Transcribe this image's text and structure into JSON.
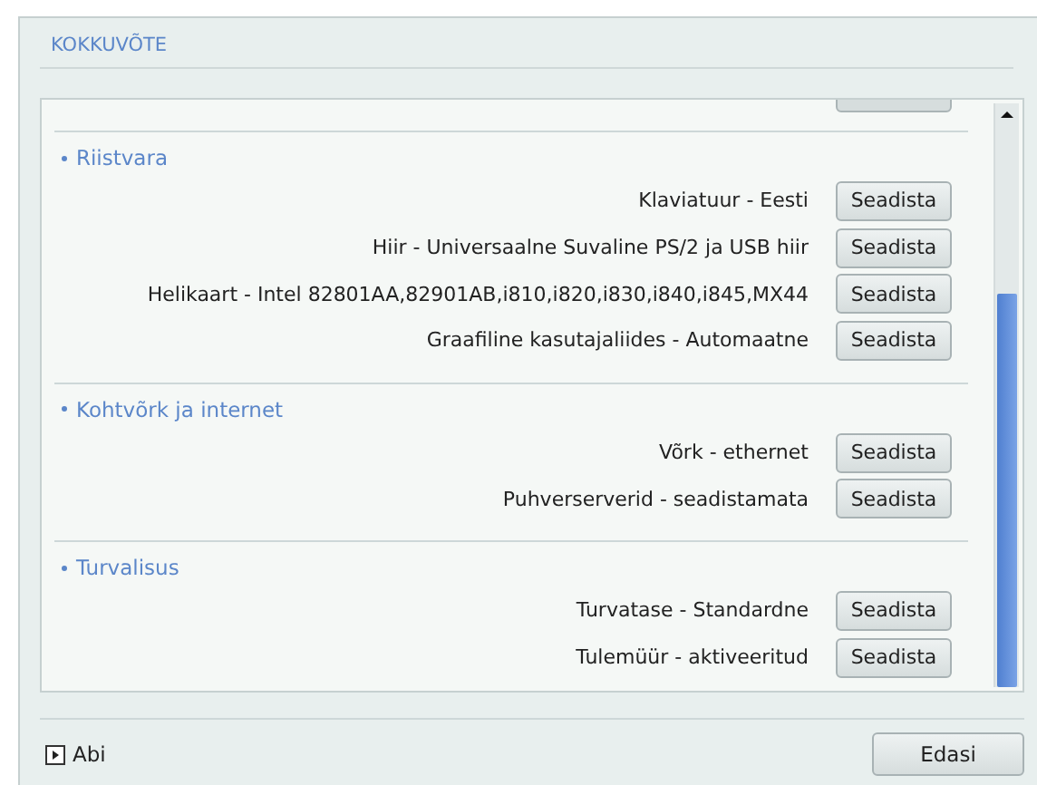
{
  "title": "KOKKUVÕTE",
  "sections": [
    {
      "title": "Riistvara",
      "items": [
        {
          "label": "Klaviatuur - Eesti",
          "button": "Seadista"
        },
        {
          "label": "Hiir - Universaalne Suvaline PS/2 ja USB hiir",
          "button": "Seadista"
        },
        {
          "label": "Helikaart - Intel 82801AA,82901AB,i810,i820,i830,i840,i845,MX44",
          "button": "Seadista"
        },
        {
          "label": "Graafiline kasutajaliides - Automaatne",
          "button": "Seadista"
        }
      ]
    },
    {
      "title": "Kohtvõrk ja internet",
      "items": [
        {
          "label": "Võrk - ethernet",
          "button": "Seadista"
        },
        {
          "label": "Puhverserverid - seadistamata",
          "button": "Seadista"
        }
      ]
    },
    {
      "title": "Turvalisus",
      "items": [
        {
          "label": "Turvatase - Standardne",
          "button": "Seadista"
        },
        {
          "label": "Tulemüür - aktiveeritud",
          "button": "Seadista"
        }
      ]
    }
  ],
  "help": {
    "label": "Abi",
    "expanded": false
  },
  "next_button": "Edasi"
}
